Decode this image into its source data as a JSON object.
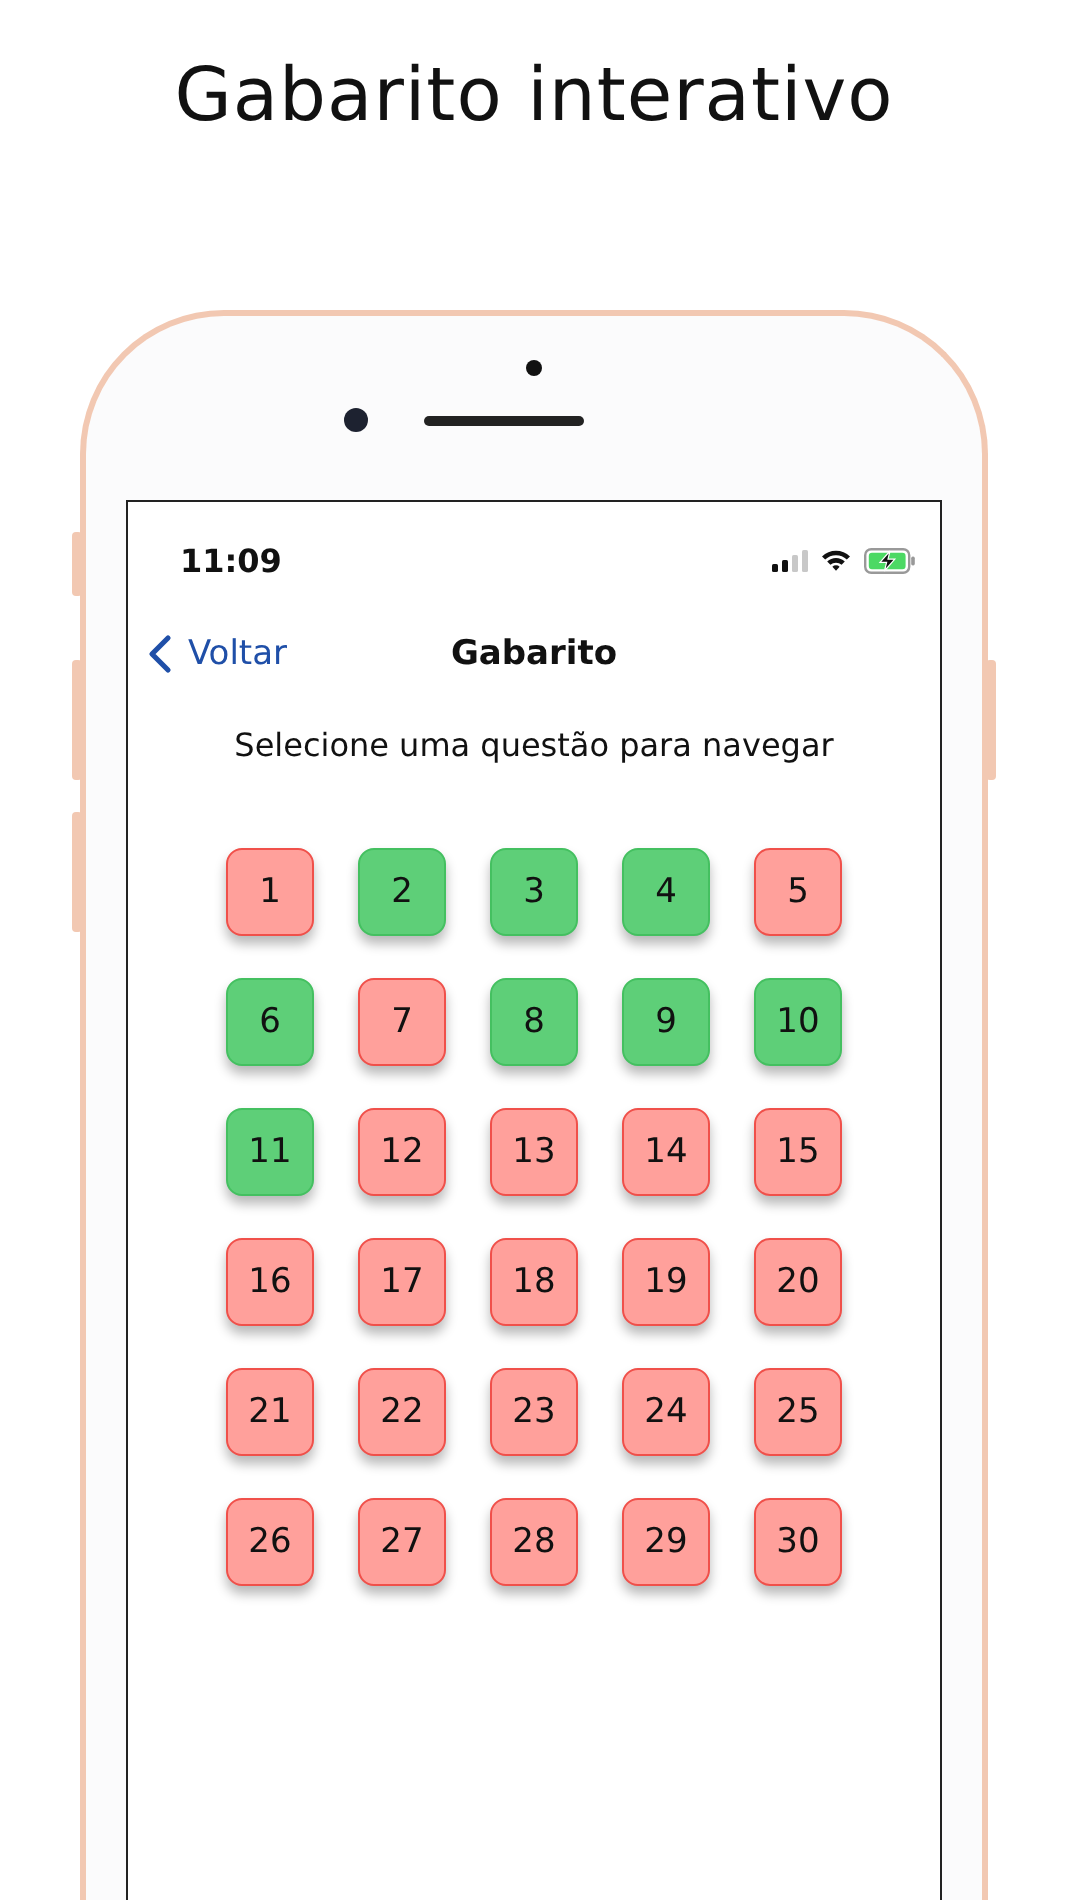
{
  "headline": "Gabarito interativo",
  "status_bar": {
    "time": "11:09"
  },
  "nav": {
    "back": "Voltar",
    "title": "Gabarito"
  },
  "prompt": "Selecione uma questão para navegar",
  "questions": [
    {
      "number": "1",
      "color": "#ffa09b"
    },
    {
      "number": "2",
      "color": "#5ecf78"
    },
    {
      "number": "3",
      "color": "#5ecf78"
    },
    {
      "number": "4",
      "color": "#5ecf78"
    },
    {
      "number": "5",
      "color": "#ffa09b"
    },
    {
      "number": "6",
      "color": "#5ecf78"
    },
    {
      "number": "7",
      "color": "#ffa09b"
    },
    {
      "number": "8",
      "color": "#5ecf78"
    },
    {
      "number": "9",
      "color": "#5ecf78"
    },
    {
      "number": "10",
      "color": "#5ecf78"
    },
    {
      "number": "11",
      "color": "#5ecf78"
    },
    {
      "number": "12",
      "color": "#ffa09b"
    },
    {
      "number": "13",
      "color": "#ffa09b"
    },
    {
      "number": "14",
      "color": "#ffa09b"
    },
    {
      "number": "15",
      "color": "#ffa09b"
    },
    {
      "number": "16",
      "color": "#ffa09b"
    },
    {
      "number": "17",
      "color": "#ffa09b"
    },
    {
      "number": "18",
      "color": "#ffa09b"
    },
    {
      "number": "19",
      "color": "#ffa09b"
    },
    {
      "number": "20",
      "color": "#ffa09b"
    },
    {
      "number": "21",
      "color": "#ffa09b"
    },
    {
      "number": "22",
      "color": "#ffa09b"
    },
    {
      "number": "23",
      "color": "#ffa09b"
    },
    {
      "number": "24",
      "color": "#ffa09b"
    },
    {
      "number": "25",
      "color": "#ffa09b"
    },
    {
      "number": "26",
      "color": "#ffa09b"
    },
    {
      "number": "27",
      "color": "#ffa09b"
    },
    {
      "number": "28",
      "color": "#ffa09b"
    },
    {
      "number": "29",
      "color": "#ffa09b"
    },
    {
      "number": "30",
      "color": "#ffa09b"
    }
  ]
}
